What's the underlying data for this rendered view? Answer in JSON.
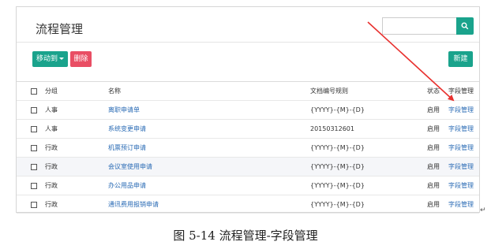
{
  "page": {
    "title": "流程管理",
    "search_placeholder": "",
    "buttons": {
      "move_to": "移动到",
      "delete": "删除",
      "new": "新建"
    }
  },
  "table": {
    "headers": {
      "group": "分组",
      "name": "名称",
      "rule": "文档编号规则",
      "state": "状态",
      "field": "字段管理"
    },
    "rows": [
      {
        "group": "人事",
        "name": "离职申请单",
        "rule": "{YYYY}-{M}-{D}",
        "state": "启用",
        "field": "字段管理"
      },
      {
        "group": "人事",
        "name": "系统变更申请",
        "rule": "20150312601",
        "state": "启用",
        "field": "字段管理"
      },
      {
        "group": "行政",
        "name": "机票预订申请",
        "rule": "{YYYY}-{M}-{D}",
        "state": "启用",
        "field": "字段管理"
      },
      {
        "group": "行政",
        "name": "会议室使用申请",
        "rule": "{YYYY}-{M}-{D}",
        "state": "启用",
        "field": "字段管理"
      },
      {
        "group": "行政",
        "name": "办公用品申请",
        "rule": "{YYYY}-{M}-{D}",
        "state": "启用",
        "field": "字段管理"
      },
      {
        "group": "行政",
        "name": "通讯费用报销申请",
        "rule": "{YYYY}-{M}-{D}",
        "state": "启用",
        "field": "字段管理"
      }
    ]
  },
  "figure_caption": "图 5-14 流程管理-字段管理",
  "paragraph_mark": "↵",
  "colors": {
    "accent": "#1aa38c",
    "danger": "#e94e64",
    "link": "#2a6bb5",
    "annotation_arrow": "#e8312f"
  },
  "icons": {
    "search": "search-icon",
    "caret": "caret-down-icon",
    "checkbox": "checkbox-icon"
  }
}
